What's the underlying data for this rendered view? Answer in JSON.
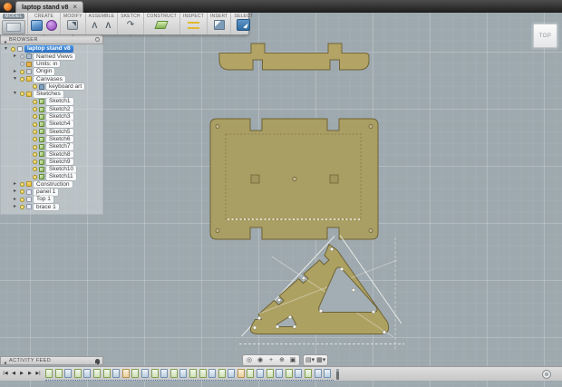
{
  "window": {
    "tab": {
      "title": "laptop stand v8",
      "close_glyph": "×"
    }
  },
  "toolbar": {
    "workspace": {
      "label": "MODEL"
    },
    "groups": [
      {
        "label": "CREATE",
        "icons": [
          "box-icon",
          "create-form-icon"
        ]
      },
      {
        "label": "MODIFY",
        "icons": [
          "press-pull-icon"
        ]
      },
      {
        "label": "ASSEMBLE",
        "icons": [
          "joint-icon",
          "as-built-joint-icon"
        ]
      },
      {
        "label": "SKETCH",
        "icons": [
          "sketch-spline-icon"
        ]
      },
      {
        "label": "CONSTRUCT",
        "icons": [
          "construction-plane-icon"
        ]
      },
      {
        "label": "INSPECT",
        "icons": [
          "measure-icon"
        ]
      },
      {
        "label": "INSERT",
        "icons": [
          "insert-canvas-icon"
        ]
      },
      {
        "label": "SELECT",
        "icons": [
          "select-icon"
        ]
      }
    ]
  },
  "browser": {
    "title": "BROWSER",
    "items": [
      {
        "label": "laptop stand v8",
        "indent": 0,
        "icon": "document-icon",
        "expander": "open",
        "selected": true,
        "bulb": true
      },
      {
        "label": "Named Views",
        "indent": 1,
        "icon": "named-views-icon",
        "expander": "closed",
        "bulb": false
      },
      {
        "label": "Units: in",
        "indent": 1,
        "icon": "units-icon",
        "bulb": false
      },
      {
        "label": "Origin",
        "indent": 1,
        "icon": "origin-icon",
        "expander": "closed",
        "bulb": true
      },
      {
        "label": "Canvases",
        "indent": 1,
        "icon": "folder-icon",
        "expander": "open",
        "bulb": true
      },
      {
        "label": "keyboard art",
        "indent": 2,
        "icon": "canvas-icon",
        "bulb": true
      },
      {
        "label": "Sketches",
        "indent": 1,
        "icon": "folder-icon",
        "expander": "open",
        "bulb": true
      },
      {
        "label": "Sketch1",
        "indent": 2,
        "icon": "sketch-icon",
        "bulb": true
      },
      {
        "label": "Sketch2",
        "indent": 2,
        "icon": "sketch-icon",
        "bulb": true
      },
      {
        "label": "Sketch3",
        "indent": 2,
        "icon": "sketch-icon",
        "bulb": true
      },
      {
        "label": "Sketch4",
        "indent": 2,
        "icon": "sketch-icon",
        "bulb": true
      },
      {
        "label": "Sketch5",
        "indent": 2,
        "icon": "sketch-icon",
        "bulb": true
      },
      {
        "label": "Sketch6",
        "indent": 2,
        "icon": "sketch-icon",
        "bulb": true
      },
      {
        "label": "Sketch7",
        "indent": 2,
        "icon": "sketch-icon",
        "bulb": true
      },
      {
        "label": "Sketch8",
        "indent": 2,
        "icon": "sketch-icon",
        "bulb": true
      },
      {
        "label": "Sketch9",
        "indent": 2,
        "icon": "sketch-icon",
        "bulb": true
      },
      {
        "label": "Sketch10",
        "indent": 2,
        "icon": "sketch-icon",
        "bulb": true
      },
      {
        "label": "Sketch11",
        "indent": 2,
        "icon": "sketch-icon",
        "bulb": true
      },
      {
        "label": "Construction",
        "indent": 1,
        "icon": "folder-icon",
        "expander": "closed",
        "bulb": true
      },
      {
        "label": "panel 1",
        "indent": 1,
        "icon": "component-icon",
        "expander": "closed",
        "bulb": true
      },
      {
        "label": "Top 1",
        "indent": 1,
        "icon": "component-icon",
        "expander": "closed",
        "bulb": true
      },
      {
        "label": "brace 1",
        "indent": 1,
        "icon": "component-icon",
        "expander": "closed",
        "bulb": true
      }
    ]
  },
  "viewcube": {
    "top_label": "TOP"
  },
  "activity_feed": {
    "title": "ACTIVITY FEED"
  },
  "navbar": {
    "view_buttons": [
      {
        "icon": "orbit-icon",
        "glyph": "◎"
      },
      {
        "icon": "look-at-icon",
        "glyph": "◉"
      },
      {
        "icon": "pan-icon",
        "glyph": "+"
      },
      {
        "icon": "zoom-icon",
        "glyph": "⊕"
      },
      {
        "icon": "fit-icon",
        "glyph": "▣"
      }
    ],
    "display_buttons": [
      {
        "icon": "display-settings-icon",
        "glyph": "▤▾"
      },
      {
        "icon": "grid-layout-icon",
        "glyph": "▦▾"
      }
    ]
  },
  "timeline": {
    "playback": [
      {
        "icon": "skip-to-start-icon",
        "glyph": "|◀"
      },
      {
        "icon": "step-back-icon",
        "glyph": "◀"
      },
      {
        "icon": "play-icon",
        "glyph": "▶"
      },
      {
        "icon": "step-forward-icon",
        "glyph": "▶"
      },
      {
        "icon": "skip-to-end-icon",
        "glyph": "▶|"
      }
    ],
    "features": [
      "sketch-icon",
      "sketch-icon",
      "extrude-icon",
      "sketch-icon",
      "extrude-icon",
      "sketch-icon",
      "sketch-icon",
      "extrude-icon",
      "construction-plane-icon",
      "sketch-icon",
      "extrude-icon",
      "sketch-icon",
      "extrude-icon",
      "sketch-icon",
      "extrude-icon",
      "sketch-icon",
      "sketch-icon",
      "extrude-icon",
      "sketch-icon",
      "extrude-icon",
      "construction-plane-icon",
      "sketch-icon",
      "extrude-icon",
      "sketch-icon",
      "extrude-icon",
      "sketch-icon",
      "extrude-icon",
      "sketch-icon",
      "extrude-icon",
      "extrude-icon"
    ]
  },
  "colors": {
    "canvas_background": "#9ea9af",
    "body_fill": "#b0a364",
    "body_outline": "#6e6336",
    "selection_highlight": "#f4f4ee",
    "selected_item_blue": "#3a86d8",
    "toolbar_background": "#d9d9d9",
    "tab_bar_background": "#2e2e2e"
  }
}
